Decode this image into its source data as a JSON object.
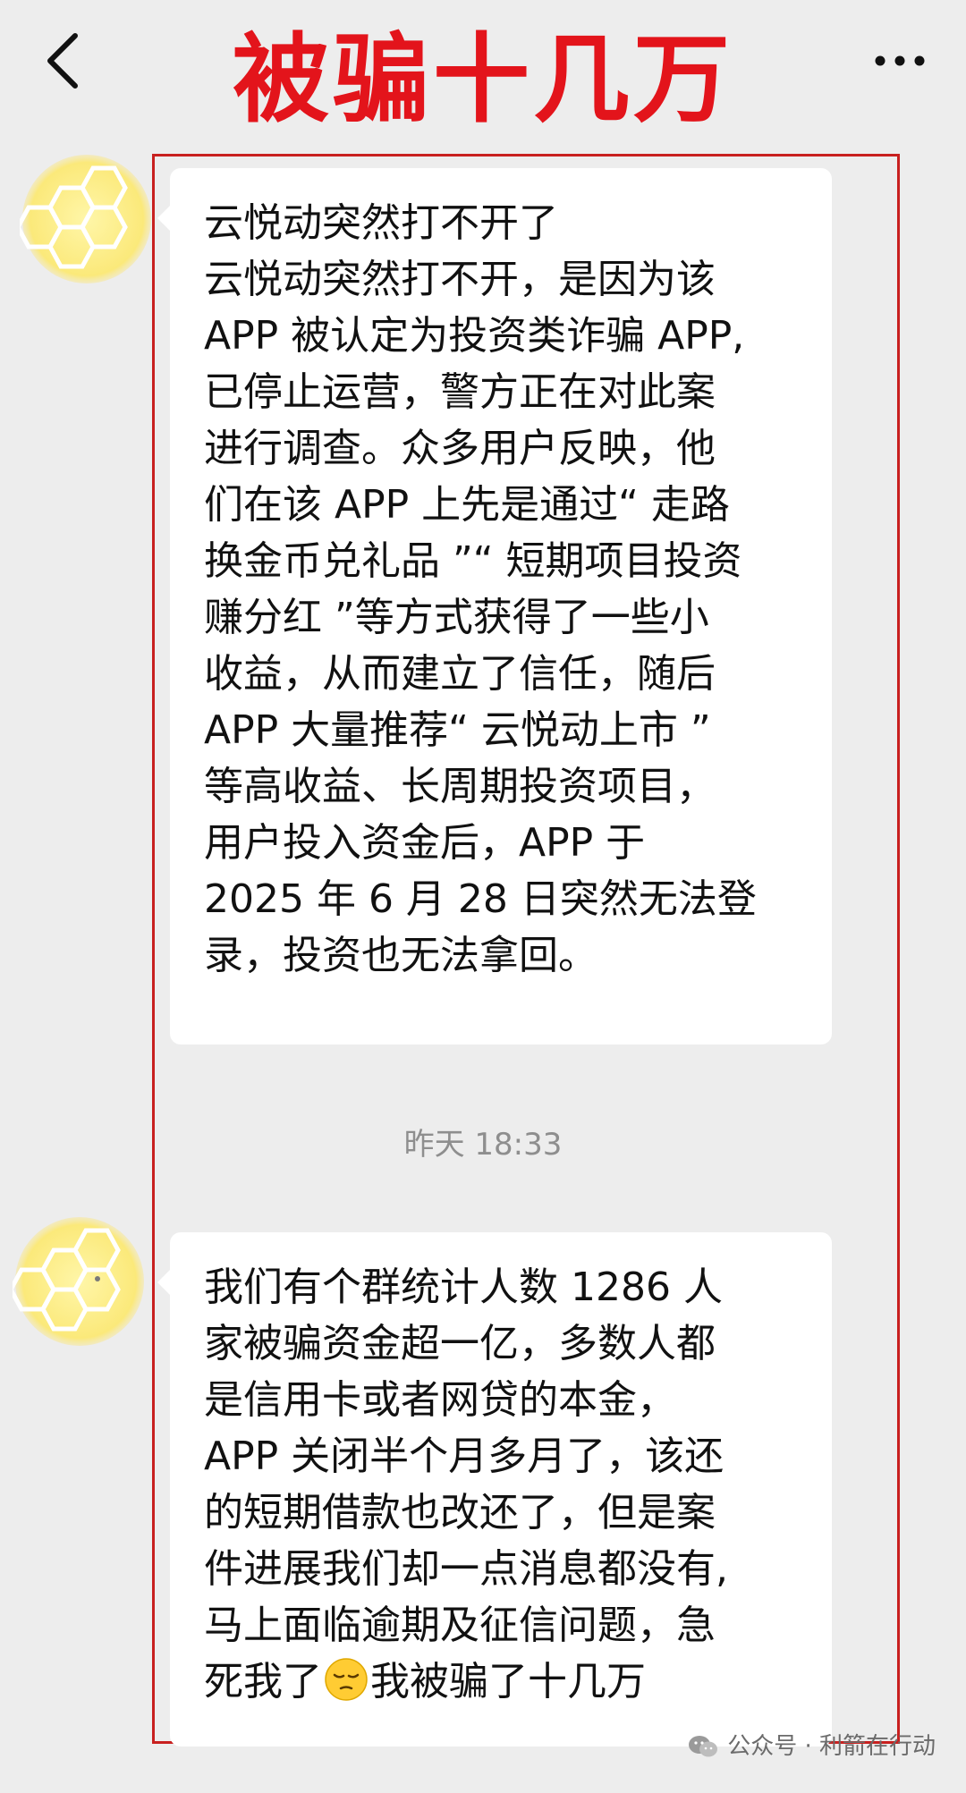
{
  "header": {
    "title": "被骗十几万",
    "back_icon": "chevron-left-icon",
    "more_icon": "more-dots-icon"
  },
  "colors": {
    "accent": "#e3141b",
    "frame": "#c8201f",
    "bubble": "#ffffff",
    "background": "#ededed"
  },
  "messages": [
    {
      "lines": [
        "云悦动突然打不开了",
        "云悦动突然打不开，是因为该",
        "APP 被认定为投资类诈骗 APP,",
        "已停止运营，警方正在对此案",
        "进行调查。众多用户反映，他",
        "们在该 APP 上先是通过“ 走路",
        "换金币兑礼品 ”“ 短期项目投资",
        "赚分红 ”等方式获得了一些小",
        "收益，从而建立了信任，随后",
        "APP 大量推荐“ 云悦动上市 ”",
        "等高收益、长周期投资项目，",
        "用户投入资金后，APP 于",
        "2025 年 6 月 28 日突然无法登",
        "录，投资也无法拿回。"
      ]
    },
    {
      "lines": [
        "我们有个群统计人数 1286 人",
        "家被骗资金超一亿，多数人都",
        "是信用卡或者网贷的本金，",
        "APP 关闭半个月多月了，该还",
        "的短期借款也改还了，但是案",
        "件进展我们却一点消息都没有,",
        "马上面临逾期及征信问题，急"
      ],
      "last_line_before_emoji": "死我了",
      "emoji": "pensive-face-emoji",
      "last_line_after_emoji": "我被骗了十几万"
    }
  ],
  "timestamp": "昨天 18:33",
  "watermark": "公众号 · 利箭在行动"
}
